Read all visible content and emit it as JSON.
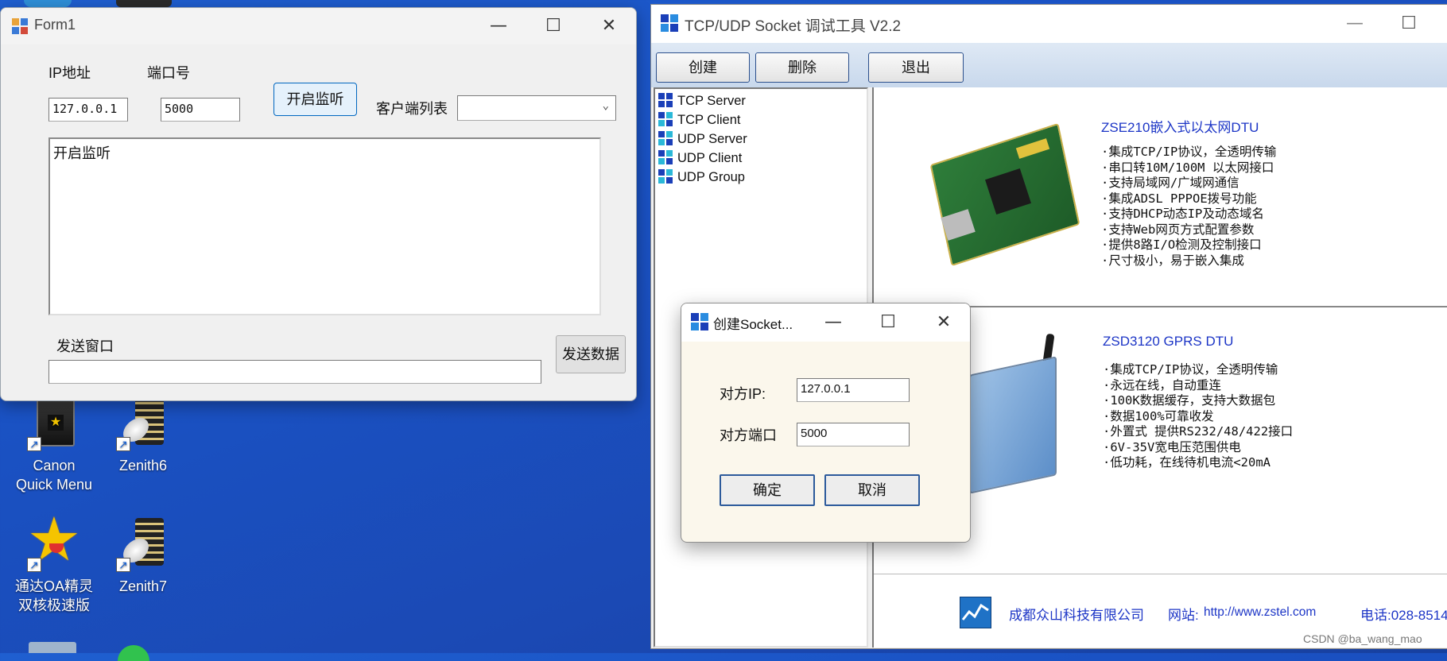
{
  "desktop": {
    "icons": [
      {
        "label_line1": "Canon",
        "label_line2": "Quick Menu",
        "icon": "canon-quick-menu-icon"
      },
      {
        "label_line1": "Zenith6",
        "label_line2": "",
        "icon": "zenith-icon"
      },
      {
        "label_line1": "通达OA精灵",
        "label_line2": "双核极速版",
        "icon": "star-icon"
      },
      {
        "label_line1": "Zenith7",
        "label_line2": "",
        "icon": "zenith-icon"
      }
    ],
    "watermark": "CSDN @ba_wang_mao"
  },
  "form1": {
    "title": "Form1",
    "ip_label": "IP地址",
    "port_label": "端口号",
    "ip_value": "127.0.0.1",
    "port_value": "5000",
    "start_listen_button": "开启监听",
    "client_list_label": "客户端列表",
    "client_list_selected": "",
    "log_text": "开启监听",
    "send_window_label": "发送窗口",
    "send_input_value": "",
    "send_button": "发送数据"
  },
  "tool": {
    "title": "TCP/UDP Socket 调试工具 V2.2",
    "toolbar": {
      "create": "创建",
      "delete": "删除",
      "exit": "退出"
    },
    "tree": [
      "TCP Server",
      "TCP Client",
      "UDP Server",
      "UDP Client",
      "UDP Group"
    ],
    "products": [
      {
        "title": "ZSE210嵌入式以太网DTU",
        "features": [
          "·集成TCP/IP协议，全透明传输",
          "·串口转10M/100M 以太网接口",
          "·支持局域网/广域网通信",
          "·集成ADSL PPPOE拨号功能",
          "·支持DHCP动态IP及动态域名",
          "·支持Web网页方式配置参数",
          "·提供8路I/O检测及控制接口",
          "·尺寸极小，易于嵌入集成"
        ]
      },
      {
        "title": "ZSD3120 GPRS DTU",
        "features": [
          "·集成TCP/IP协议，全透明传输",
          "·永远在线，自动重连",
          "·100K数据缓存，支持大数据包",
          "·数据100%可靠收发",
          "·外置式 提供RS232/48/422接口",
          "·6V-35V宽电压范围供电",
          "·低功耗，在线待机电流<20mA"
        ]
      }
    ],
    "footer": {
      "company": "成都众山科技有限公司",
      "site_label": "网站:",
      "site_url": "http://www.zstel.com",
      "phone": "电话:028-8514"
    }
  },
  "dialog": {
    "title": "创建Socket...",
    "ip_label": "对方IP:",
    "ip_value": "127.0.0.1",
    "port_label": "对方端口",
    "port_value": "5000",
    "ok_button": "确定",
    "cancel_button": "取消"
  },
  "colors": {
    "desktop_bg": "#1b4fc0",
    "tool_title_icon": "#1a3fb8",
    "product_title": "#1c35c6"
  }
}
